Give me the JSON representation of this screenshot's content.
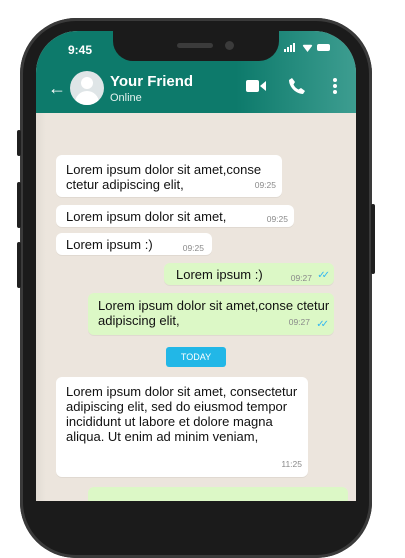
{
  "status_bar": {
    "time": "9:45"
  },
  "header": {
    "contact_name": "Your Friend",
    "contact_status": "Online"
  },
  "messages": [
    {
      "direction": "in",
      "text": "Lorem ipsum dolor sit amet,conse ctetur adipiscing elit,",
      "time": "09:25"
    },
    {
      "direction": "in",
      "text": "Lorem ipsum dolor sit amet,",
      "time": "09:25"
    },
    {
      "direction": "in",
      "text": "Lorem ipsum :)",
      "time": "09:25"
    },
    {
      "direction": "out",
      "text": "Lorem ipsum :)",
      "time": "09:27",
      "read": true
    },
    {
      "direction": "out",
      "text": "Lorem ipsum dolor sit amet,conse ctetur adipiscing elit,",
      "time": "09:27",
      "read": true
    },
    {
      "direction": "in",
      "text": "Lorem ipsum dolor sit amet, consectetur adipiscing elit, sed do eiusmod tempor incididunt ut labore et dolore magna aliqua. Ut enim ad minim veniam,",
      "time": "11:25"
    }
  ],
  "date_divider": "TODAY",
  "colors": {
    "header": "#0d7a6b",
    "outgoing_bubble": "#dcf8c6",
    "incoming_bubble": "#ffffff",
    "chat_bg": "#ece5dd",
    "tick": "#34b7f1",
    "date_chip": "#22b7e7"
  },
  "icons": {
    "back": "arrow-left-icon",
    "video": "video-camera-icon",
    "call": "phone-icon",
    "menu": "vertical-dots-icon"
  }
}
